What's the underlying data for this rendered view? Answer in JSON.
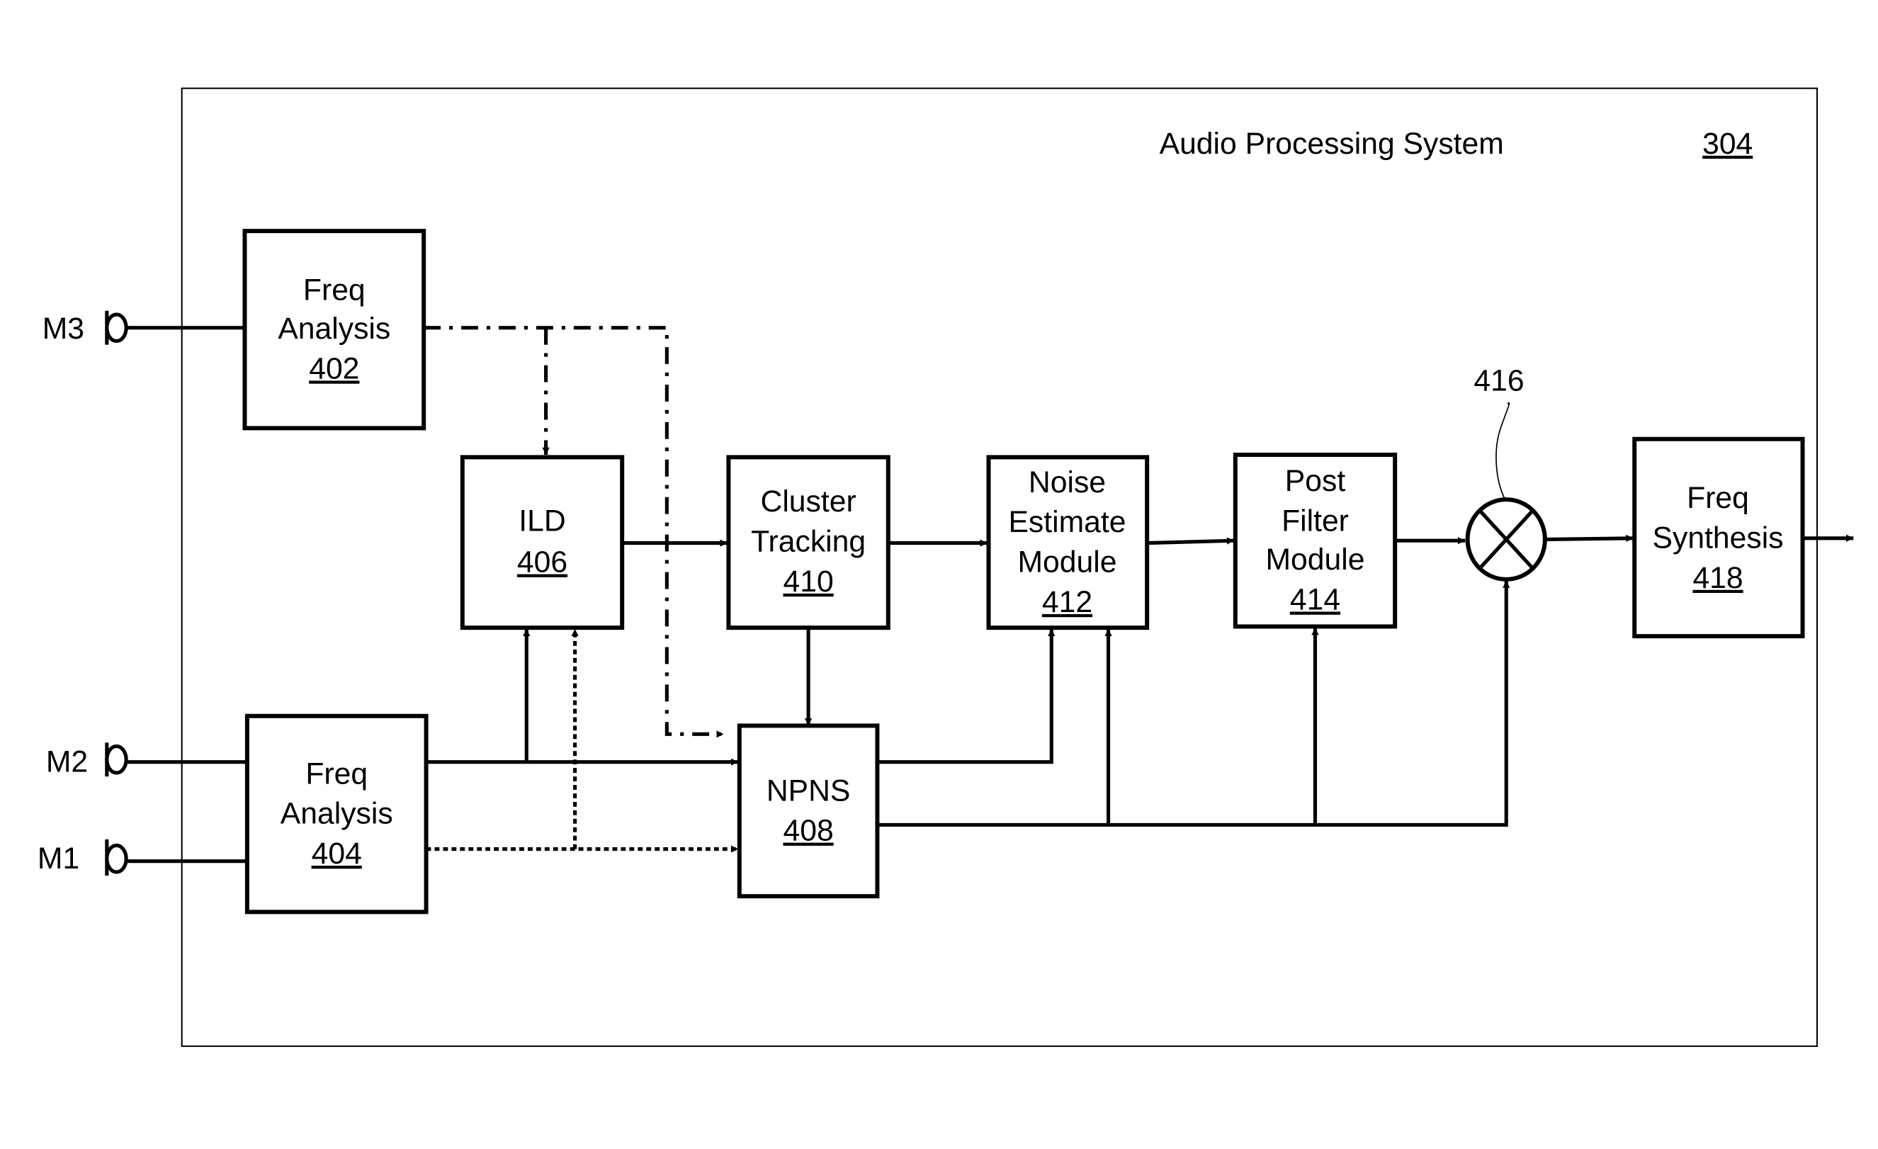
{
  "system": {
    "title": "Audio Processing System",
    "ref": "304"
  },
  "inputs": {
    "m3": "M3",
    "m2": "M2",
    "m1": "M1"
  },
  "blocks": {
    "freq_analysis_402": {
      "lines": [
        "Freq",
        "Analysis"
      ],
      "ref": "402"
    },
    "freq_analysis_404": {
      "lines": [
        "Freq",
        "Analysis"
      ],
      "ref": "404"
    },
    "ild": {
      "lines": [
        "ILD"
      ],
      "ref": "406"
    },
    "npns": {
      "lines": [
        "NPNS"
      ],
      "ref": "408"
    },
    "cluster_tracking": {
      "lines": [
        "Cluster",
        "Tracking"
      ],
      "ref": "410"
    },
    "noise_estimate": {
      "lines": [
        "Noise",
        "Estimate",
        "Module"
      ],
      "ref": "412"
    },
    "post_filter": {
      "lines": [
        "Post",
        "Filter",
        "Module"
      ],
      "ref": "414"
    },
    "multiplier": {
      "ref": "416"
    },
    "freq_synthesis": {
      "lines": [
        "Freq",
        "Synthesis"
      ],
      "ref": "418"
    }
  }
}
